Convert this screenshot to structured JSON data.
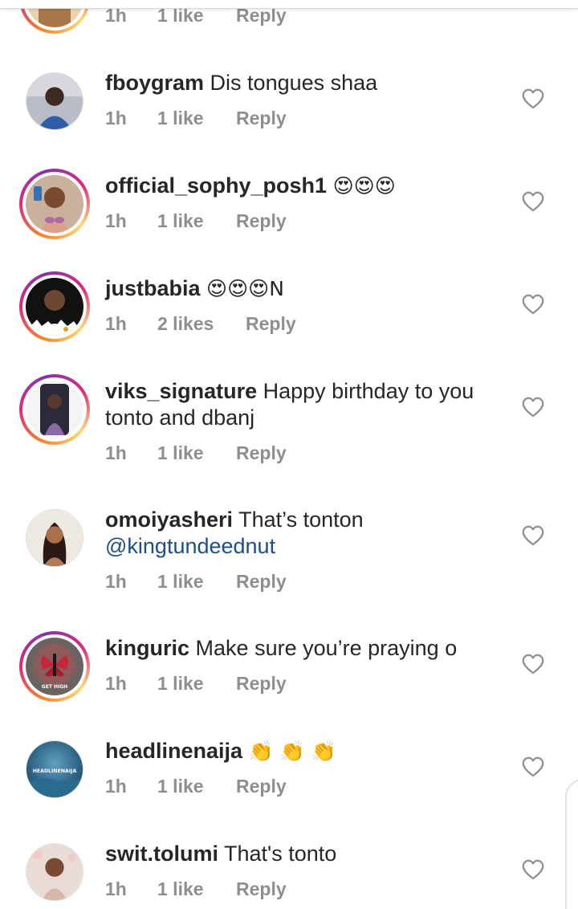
{
  "comments": [
    {
      "id": "c0",
      "username": "",
      "text": "",
      "time": "1h",
      "likes": "1 like",
      "reply": "Reply",
      "avatar": "partial-avatar",
      "story": true
    },
    {
      "id": "c1",
      "username": "fboygram",
      "text": "Dis tongues shaa",
      "time": "1h",
      "likes": "1 like",
      "reply": "Reply",
      "story": false
    },
    {
      "id": "c2",
      "username": "official_sophy_posh1",
      "text": "😍😍😍",
      "time": "1h",
      "likes": "1 like",
      "reply": "Reply",
      "story": true
    },
    {
      "id": "c3",
      "username": "justbabia",
      "text": "😍😍😍N",
      "time": "1h",
      "likes": "2 likes",
      "reply": "Reply",
      "story": true
    },
    {
      "id": "c4",
      "username": "viks_signature",
      "text_line1": "Happy birthday to you",
      "text_line2": "tonto and dbanj",
      "time": "1h",
      "likes": "1 like",
      "reply": "Reply",
      "story": true
    },
    {
      "id": "c5",
      "username": "omoiyasheri",
      "text": "That’s tonton",
      "mention": "@kingtundeednut",
      "time": "1h",
      "likes": "1 like",
      "reply": "Reply",
      "story": false
    },
    {
      "id": "c6",
      "username": "kinguric",
      "text": "Make sure you’re praying o",
      "time": "1h",
      "likes": "1 like",
      "reply": "Reply",
      "story": true,
      "avatar_text": "GET HIGH"
    },
    {
      "id": "c7",
      "username": "headlinenaija",
      "text": "👏 👏 👏",
      "time": "1h",
      "likes": "1 like",
      "reply": "Reply",
      "story": false,
      "avatar_text": "HEADLINENAIJA"
    },
    {
      "id": "c8",
      "username": "swit.tolumi",
      "text": "That's tonto",
      "time": "1h",
      "likes": "1 like",
      "reply": "Reply",
      "story": false
    }
  ],
  "icons": {
    "like": "heart-outline-icon"
  },
  "colors": {
    "meta": "#8e8e8e",
    "mention": "#1d4f86",
    "story_ring_start": "#f58529",
    "story_ring_end": "#dd2a7b"
  }
}
